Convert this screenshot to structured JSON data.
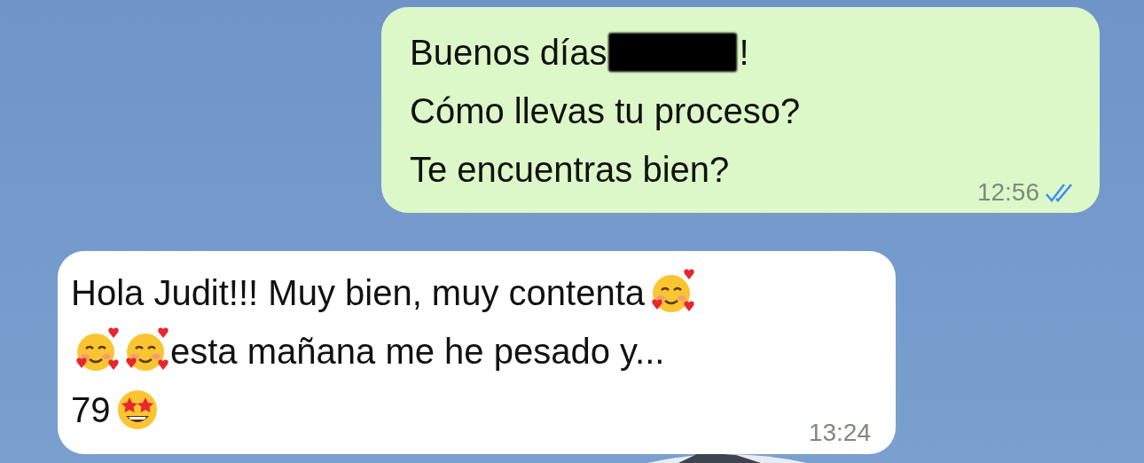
{
  "messages": [
    {
      "kind": "outgoing",
      "lines": [
        [
          {
            "kind": "text",
            "text": "Buenos días"
          },
          {
            "kind": "redaction"
          },
          {
            "kind": "text",
            "text": "!"
          }
        ],
        [
          {
            "kind": "text",
            "text": "Cómo llevas tu proceso?"
          }
        ],
        [
          {
            "kind": "text",
            "text": "Te encuentras bien?"
          }
        ]
      ],
      "time": "12:56",
      "read": true
    },
    {
      "kind": "incoming",
      "lines": [
        [
          {
            "kind": "text",
            "text": "Hola Judit!!! Muy bien, muy contenta"
          },
          {
            "kind": "hearts_emoji"
          }
        ],
        [
          {
            "kind": "hearts_emoji"
          },
          {
            "kind": "hearts_emoji"
          },
          {
            "kind": "text",
            "text": "esta mañana me he pesado y..."
          }
        ],
        [
          {
            "kind": "text",
            "text": "79"
          },
          {
            "kind": "star_emoji"
          }
        ]
      ],
      "time": "13:24"
    }
  ]
}
